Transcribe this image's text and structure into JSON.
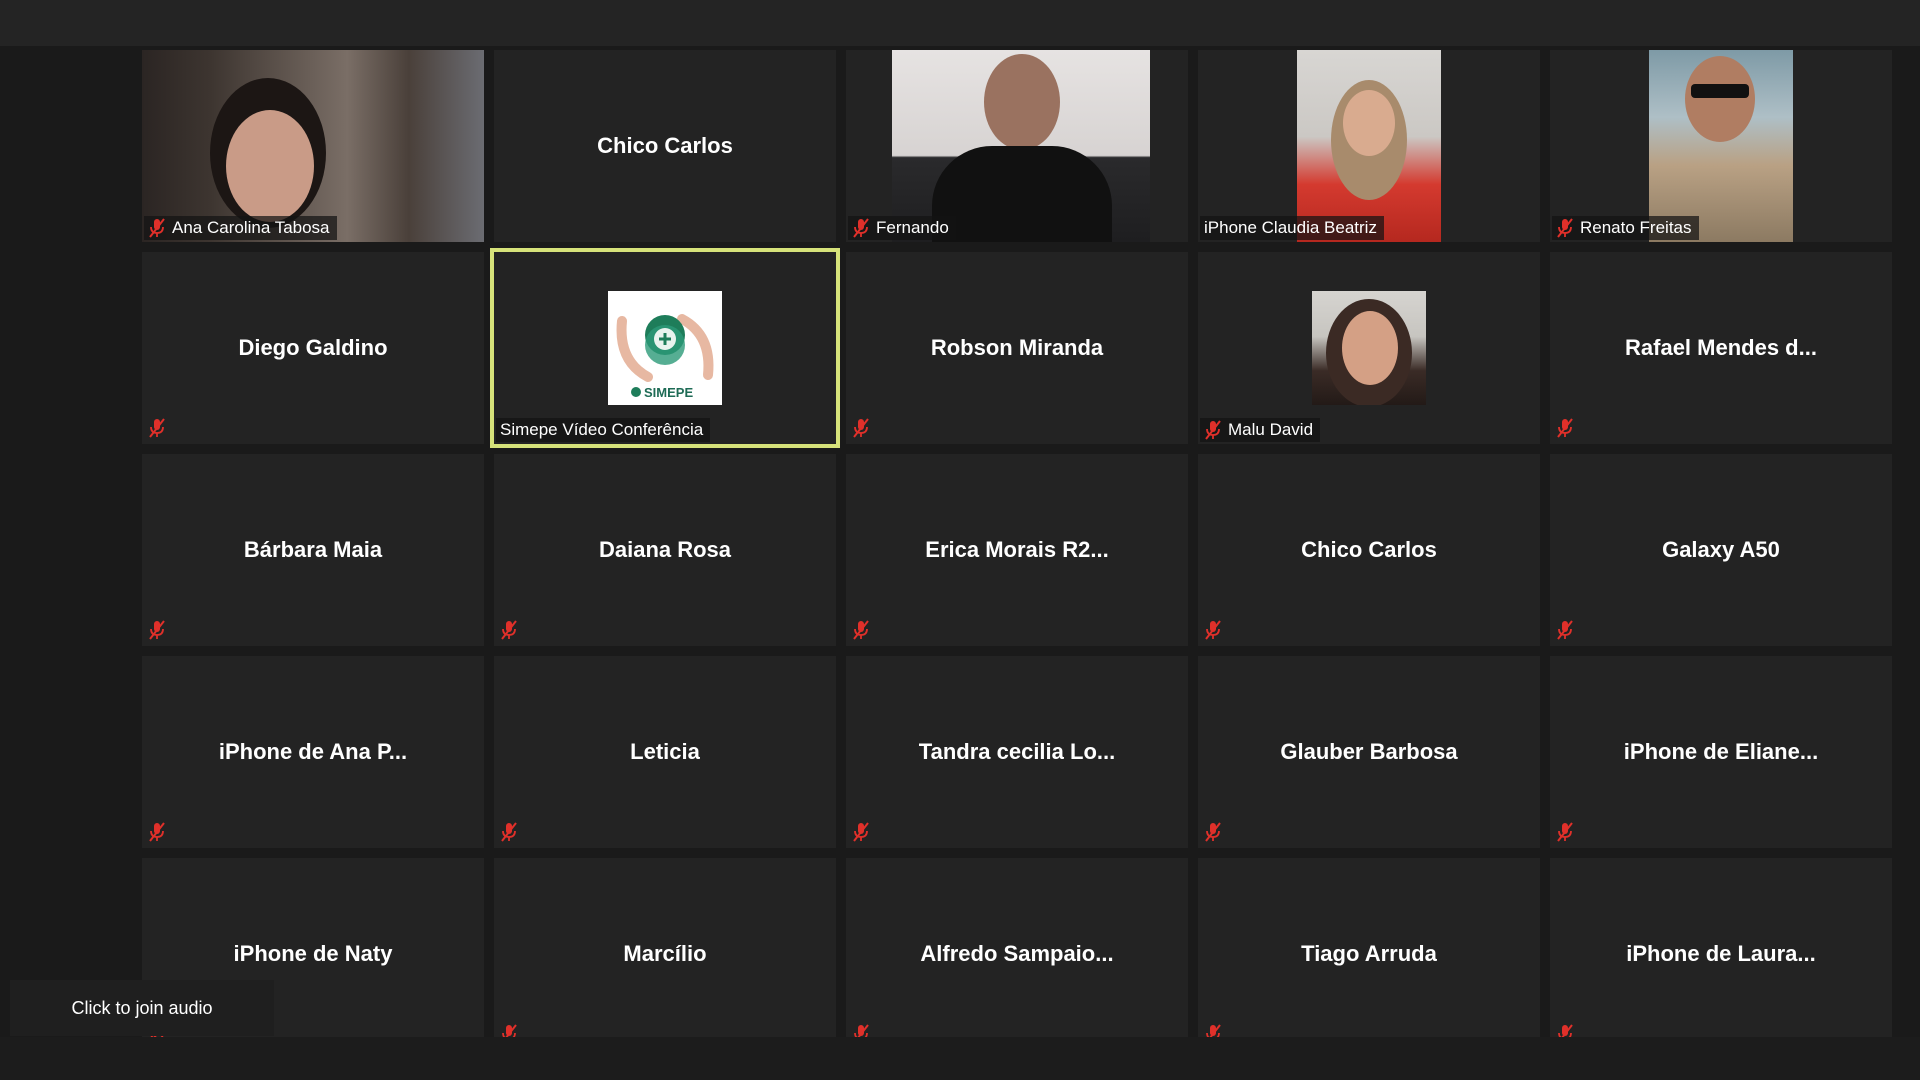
{
  "colors": {
    "background": "#1a1a1a",
    "tile": "#232323",
    "active_speaker_border": "#d6e27a",
    "muted_icon": "#e0302a"
  },
  "participants": [
    {
      "name": "Ana Carolina Tabosa",
      "muted": true,
      "video": "ana"
    },
    {
      "name": "Chico Carlos",
      "muted": false,
      "video": null
    },
    {
      "name": "Fernando",
      "muted": true,
      "video": "fernando"
    },
    {
      "name": "iPhone Claudia Beatriz",
      "muted": false,
      "video": "claudia"
    },
    {
      "name": "Renato Freitas",
      "muted": true,
      "video": "renato"
    },
    {
      "name": "Diego Galdino",
      "muted": true,
      "video": null
    },
    {
      "name": "Simepe Vídeo Conferência",
      "muted": false,
      "video": "simepe-logo",
      "logo_text": "SIMEPE",
      "active_speaker": true
    },
    {
      "name": "Robson Miranda",
      "muted": true,
      "video": null
    },
    {
      "name": "Malu David",
      "muted": true,
      "video": "malu-photo"
    },
    {
      "name": "Rafael Mendes d...",
      "muted": true,
      "video": null
    },
    {
      "name": "Bárbara Maia",
      "muted": true,
      "video": null
    },
    {
      "name": "Daiana Rosa",
      "muted": true,
      "video": null
    },
    {
      "name": "Erica Morais R2...",
      "muted": true,
      "video": null
    },
    {
      "name": "Chico Carlos",
      "muted": true,
      "video": null
    },
    {
      "name": "Galaxy A50",
      "muted": true,
      "video": null
    },
    {
      "name": "iPhone de Ana P...",
      "muted": true,
      "video": null
    },
    {
      "name": "Leticia",
      "muted": true,
      "video": null
    },
    {
      "name": "Tandra cecilia Lo...",
      "muted": true,
      "video": null
    },
    {
      "name": "Glauber Barbosa",
      "muted": true,
      "video": null
    },
    {
      "name": "iPhone de Eliane...",
      "muted": true,
      "video": null
    },
    {
      "name": "iPhone de Naty",
      "muted": true,
      "video": null
    },
    {
      "name": "Marcílio",
      "muted": true,
      "video": null
    },
    {
      "name": "Alfredo  Sampaio...",
      "muted": true,
      "video": null
    },
    {
      "name": "Tiago Arruda",
      "muted": true,
      "video": null
    },
    {
      "name": "iPhone de Laura...",
      "muted": true,
      "video": null
    }
  ],
  "audio_button": {
    "label": "Click to join audio"
  }
}
